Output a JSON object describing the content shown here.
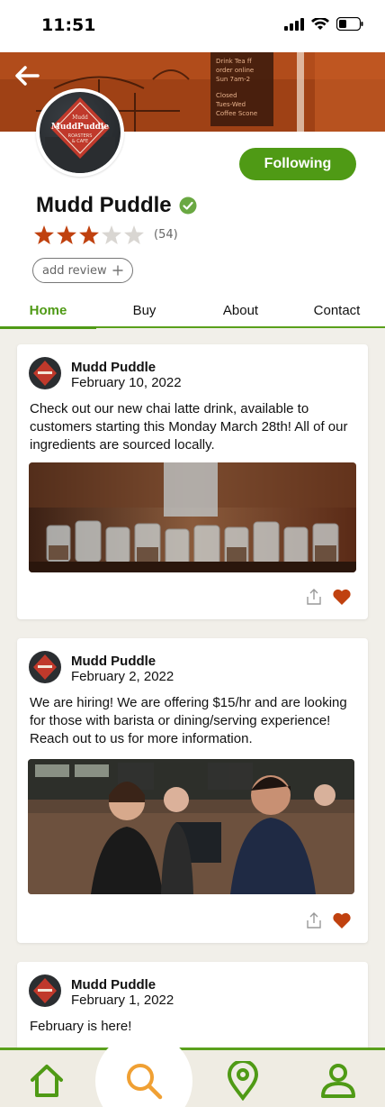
{
  "status_bar": {
    "time": "11:51"
  },
  "header": {
    "business_name": "Mudd Puddle",
    "follow_button": "Following",
    "rating": 3,
    "rating_max": 5,
    "rating_count": "(54)",
    "add_review": "add review"
  },
  "tabs": [
    {
      "label": "Home"
    },
    {
      "label": "Buy"
    },
    {
      "label": "About"
    },
    {
      "label": "Contact"
    }
  ],
  "posts": [
    {
      "author": "Mudd Puddle",
      "date": "February 10, 2022",
      "text": "Check out our new chai latte drink, available to customers starting this Monday March 28th! All of our ingredients are sourced locally."
    },
    {
      "author": "Mudd Puddle",
      "date": "February 2, 2022",
      "text": "We are hiring! We are offering $15/hr and are looking for those with barista or dining/serving experience! Reach out to us for more information."
    },
    {
      "author": "Mudd Puddle",
      "date": "February 1, 2022",
      "text": "February is here!"
    }
  ],
  "colors": {
    "accent_green": "#4f9a15",
    "star_orange": "#c0410f",
    "heart_orange": "#c0410f"
  },
  "icons": {
    "back": "back-arrow-icon",
    "share": "share-icon",
    "heart": "heart-icon",
    "home": "home-icon",
    "search": "search-icon",
    "location": "map-pin-icon",
    "profile": "user-icon"
  }
}
